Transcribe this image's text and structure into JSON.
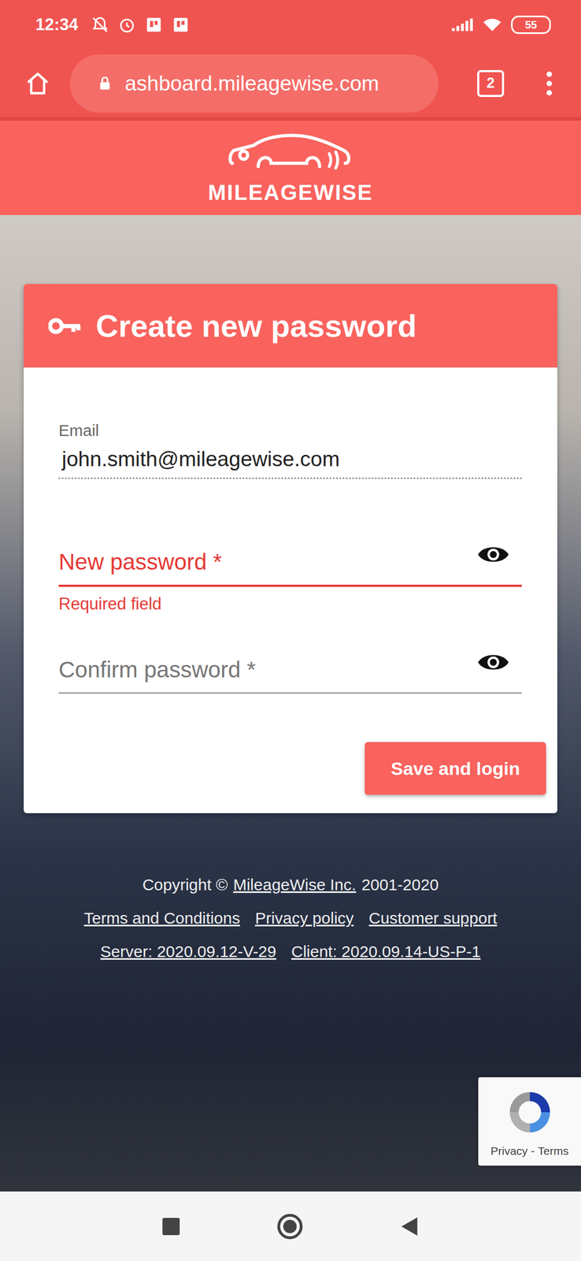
{
  "status_bar": {
    "time": "12:34",
    "battery": "55"
  },
  "browser": {
    "url": "ashboard.mileagewise.com",
    "tab_count": "2"
  },
  "header": {
    "logo": "MILEAGEWISE"
  },
  "form": {
    "title": "Create new password",
    "email_label": "Email",
    "email": "john.smith@mileagewise.com",
    "fields": [
      {
        "label": "New password *",
        "error": "Required field",
        "invalid": true
      },
      {
        "label": "Confirm password *",
        "error": "",
        "invalid": false
      }
    ],
    "submit": "Save and login"
  },
  "footer": {
    "copyright_prefix": "Copyright ©",
    "company": "MileageWise Inc.",
    "years": "2001-2020",
    "links": [
      "Terms and Conditions",
      "Privacy policy",
      "Customer support"
    ],
    "versions": [
      "Server: 2020.09.12-V-29",
      "Client: 2020.09.14-US-P-1"
    ]
  },
  "recaptcha": {
    "privacy": "Privacy",
    "separator": "-",
    "terms": "Terms"
  }
}
